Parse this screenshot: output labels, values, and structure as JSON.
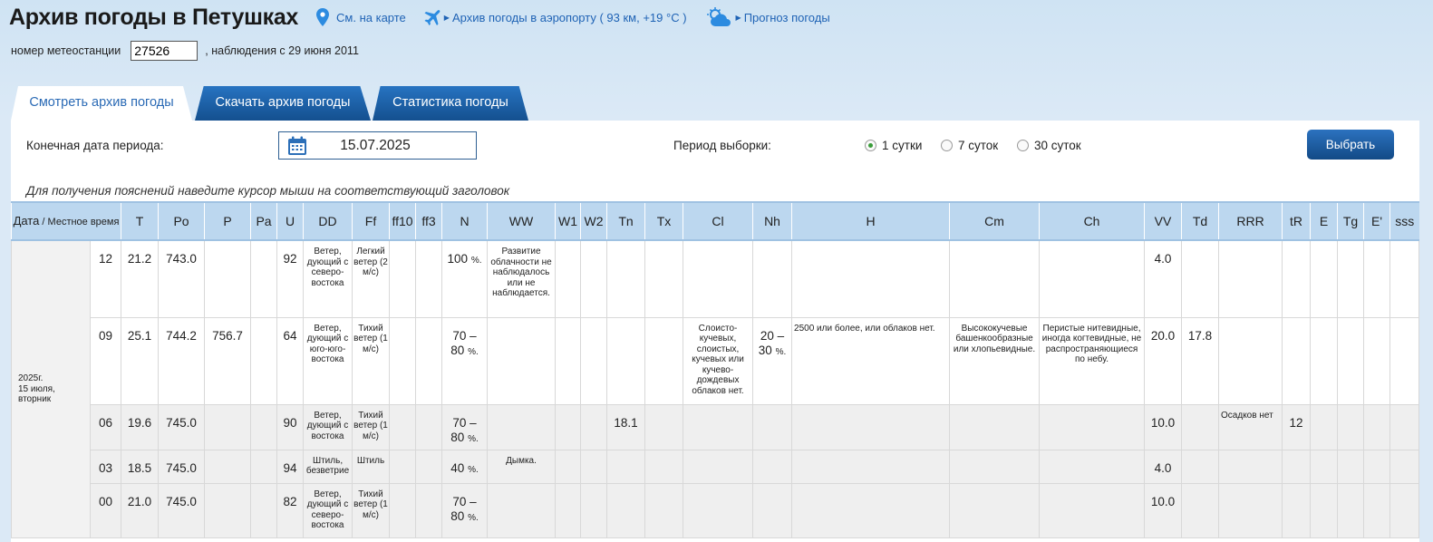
{
  "header": {
    "title": "Архив погоды в Петушках",
    "map_link": "См. на карте",
    "airport_link": "Архив погоды в аэропорту ( 93 км, +19 °C )",
    "forecast_link": "Прогноз погоды"
  },
  "station": {
    "label": "номер метеостанции",
    "number": "27526",
    "since": ", наблюдения с 29 июня 2011"
  },
  "tabs": [
    "Смотреть архив погоды",
    "Скачать архив погоды",
    "Статистика погоды"
  ],
  "controls": {
    "end_date_label": "Конечная дата периода:",
    "end_date": "15.07.2025",
    "period_label": "Период выборки:",
    "periods": [
      "1 сутки",
      "7 суток",
      "30 суток"
    ],
    "selected_period": "1 сутки",
    "submit": "Выбрать"
  },
  "hint": "Для получения пояснений наведите курсор мыши на соответствующий заголовок",
  "table": {
    "date_header": "Дата",
    "time_header": "/ Местное время",
    "columns": [
      "T",
      "Po",
      "P",
      "Pa",
      "U",
      "DD",
      "Ff",
      "ff10",
      "ff3",
      "N",
      "WW",
      "W1",
      "W2",
      "Tn",
      "Tx",
      "Cl",
      "Nh",
      "H",
      "Cm",
      "Ch",
      "VV",
      "Td",
      "RRR",
      "tR",
      "E",
      "Tg",
      "E'",
      "sss"
    ],
    "date_cell": {
      "year": "2025г.",
      "day": "15 июля,",
      "weekday": "вторник"
    },
    "rows": [
      {
        "time": "12",
        "T": "21.2",
        "Po": "743.0",
        "P": "",
        "Pa": "",
        "U": "92",
        "DD": "Ветер, дующий с северо-востока",
        "Ff": "Легкий ветер (2 м/с)",
        "ff10": "",
        "ff3": "",
        "N1": "100",
        "N2": "",
        "N_unit": "%.",
        "WW": "Развитие облачности не наблюдалось или не наблюдается.",
        "W1": "",
        "W2": "",
        "Tn": "",
        "Tx": "",
        "Cl": "",
        "Nh1": "",
        "Nh2": "",
        "H": "",
        "Cm": "",
        "Ch": "",
        "VV": "4.0",
        "Td": "",
        "RRR": "",
        "tR": "",
        "E": "",
        "Tg": "",
        "E1": "",
        "sss": ""
      },
      {
        "time": "09",
        "T": "25.1",
        "Po": "744.2",
        "P": "756.7",
        "Pa": "",
        "U": "64",
        "DD": "Ветер, дующий с юго-юго-востока",
        "Ff": "Тихий ветер (1 м/с)",
        "ff10": "",
        "ff3": "",
        "N1": "70 –",
        "N2": "80",
        "N_unit": "%.",
        "WW": "",
        "W1": "",
        "W2": "",
        "Tn": "",
        "Tx": "",
        "Cl": "Слоисто-кучевых, слоистых, кучевых или кучево-дождевых облаков нет.",
        "Nh1": "20 –",
        "Nh2": "30",
        "H": "2500 или более, или облаков нет.",
        "Cm": "Высококучевые башенкообразные или хлопьевидные.",
        "Ch": "Перистые нитевидные, иногда когтевидные, не распространяющиеся по небу.",
        "VV": "20.0",
        "Td": "17.8",
        "RRR": "",
        "tR": "",
        "E": "",
        "Tg": "",
        "E1": "",
        "sss": ""
      },
      {
        "time": "06",
        "T": "19.6",
        "Po": "745.0",
        "P": "",
        "Pa": "",
        "U": "90",
        "DD": "Ветер, дующий с востока",
        "Ff": "Тихий ветер (1 м/с)",
        "ff10": "",
        "ff3": "",
        "N1": "70 –",
        "N2": "80",
        "N_unit": "%.",
        "WW": "",
        "W1": "",
        "W2": "",
        "Tn": "18.1",
        "Tx": "",
        "Cl": "",
        "Nh1": "",
        "Nh2": "",
        "H": "",
        "Cm": "",
        "Ch": "",
        "VV": "10.0",
        "Td": "",
        "RRR": "Осадков нет",
        "tR": "12",
        "E": "",
        "Tg": "",
        "E1": "",
        "sss": ""
      },
      {
        "time": "03",
        "T": "18.5",
        "Po": "745.0",
        "P": "",
        "Pa": "",
        "U": "94",
        "DD": "Штиль, безветрие",
        "Ff": "Штиль",
        "ff10": "",
        "ff3": "",
        "N1": "40",
        "N2": "",
        "N_unit": "%.",
        "WW": "Дымка.",
        "W1": "",
        "W2": "",
        "Tn": "",
        "Tx": "",
        "Cl": "",
        "Nh1": "",
        "Nh2": "",
        "H": "",
        "Cm": "",
        "Ch": "",
        "VV": "4.0",
        "Td": "",
        "RRR": "",
        "tR": "",
        "E": "",
        "Tg": "",
        "E1": "",
        "sss": ""
      },
      {
        "time": "00",
        "T": "21.0",
        "Po": "745.0",
        "P": "",
        "Pa": "",
        "U": "82",
        "DD": "Ветер, дующий с северо-востока",
        "Ff": "Тихий ветер (1 м/с)",
        "ff10": "",
        "ff3": "",
        "N1": "70 –",
        "N2": "80",
        "N_unit": "%.",
        "WW": "",
        "W1": "",
        "W2": "",
        "Tn": "",
        "Tx": "",
        "Cl": "",
        "Nh1": "",
        "Nh2": "",
        "H": "",
        "Cm": "",
        "Ch": "",
        "VV": "10.0",
        "Td": "",
        "RRR": "",
        "tR": "",
        "E": "",
        "Tg": "",
        "E1": "",
        "sss": ""
      }
    ]
  },
  "colors": {
    "accent": "#1f63b5",
    "tab_blue": "#1a5c9f",
    "header_cell": "#bcd7ef"
  },
  "icons": [
    "map-pin-icon",
    "airplane-icon",
    "cloud-sun-icon",
    "calendar-icon"
  ]
}
